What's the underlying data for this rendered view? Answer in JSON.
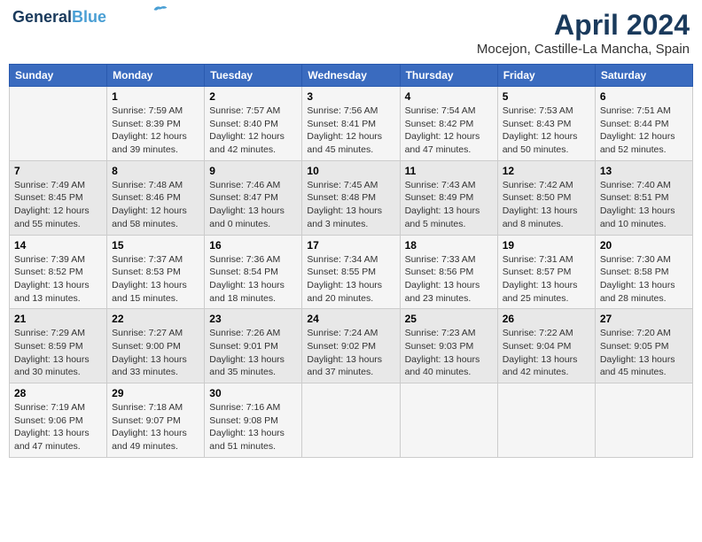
{
  "header": {
    "logo_line1": "General",
    "logo_line2": "Blue",
    "month": "April 2024",
    "location": "Mocejon, Castille-La Mancha, Spain"
  },
  "days_of_week": [
    "Sunday",
    "Monday",
    "Tuesday",
    "Wednesday",
    "Thursday",
    "Friday",
    "Saturday"
  ],
  "weeks": [
    [
      {
        "day": "",
        "info": ""
      },
      {
        "day": "1",
        "info": "Sunrise: 7:59 AM\nSunset: 8:39 PM\nDaylight: 12 hours\nand 39 minutes."
      },
      {
        "day": "2",
        "info": "Sunrise: 7:57 AM\nSunset: 8:40 PM\nDaylight: 12 hours\nand 42 minutes."
      },
      {
        "day": "3",
        "info": "Sunrise: 7:56 AM\nSunset: 8:41 PM\nDaylight: 12 hours\nand 45 minutes."
      },
      {
        "day": "4",
        "info": "Sunrise: 7:54 AM\nSunset: 8:42 PM\nDaylight: 12 hours\nand 47 minutes."
      },
      {
        "day": "5",
        "info": "Sunrise: 7:53 AM\nSunset: 8:43 PM\nDaylight: 12 hours\nand 50 minutes."
      },
      {
        "day": "6",
        "info": "Sunrise: 7:51 AM\nSunset: 8:44 PM\nDaylight: 12 hours\nand 52 minutes."
      }
    ],
    [
      {
        "day": "7",
        "info": "Sunrise: 7:49 AM\nSunset: 8:45 PM\nDaylight: 12 hours\nand 55 minutes."
      },
      {
        "day": "8",
        "info": "Sunrise: 7:48 AM\nSunset: 8:46 PM\nDaylight: 12 hours\nand 58 minutes."
      },
      {
        "day": "9",
        "info": "Sunrise: 7:46 AM\nSunset: 8:47 PM\nDaylight: 13 hours\nand 0 minutes."
      },
      {
        "day": "10",
        "info": "Sunrise: 7:45 AM\nSunset: 8:48 PM\nDaylight: 13 hours\nand 3 minutes."
      },
      {
        "day": "11",
        "info": "Sunrise: 7:43 AM\nSunset: 8:49 PM\nDaylight: 13 hours\nand 5 minutes."
      },
      {
        "day": "12",
        "info": "Sunrise: 7:42 AM\nSunset: 8:50 PM\nDaylight: 13 hours\nand 8 minutes."
      },
      {
        "day": "13",
        "info": "Sunrise: 7:40 AM\nSunset: 8:51 PM\nDaylight: 13 hours\nand 10 minutes."
      }
    ],
    [
      {
        "day": "14",
        "info": "Sunrise: 7:39 AM\nSunset: 8:52 PM\nDaylight: 13 hours\nand 13 minutes."
      },
      {
        "day": "15",
        "info": "Sunrise: 7:37 AM\nSunset: 8:53 PM\nDaylight: 13 hours\nand 15 minutes."
      },
      {
        "day": "16",
        "info": "Sunrise: 7:36 AM\nSunset: 8:54 PM\nDaylight: 13 hours\nand 18 minutes."
      },
      {
        "day": "17",
        "info": "Sunrise: 7:34 AM\nSunset: 8:55 PM\nDaylight: 13 hours\nand 20 minutes."
      },
      {
        "day": "18",
        "info": "Sunrise: 7:33 AM\nSunset: 8:56 PM\nDaylight: 13 hours\nand 23 minutes."
      },
      {
        "day": "19",
        "info": "Sunrise: 7:31 AM\nSunset: 8:57 PM\nDaylight: 13 hours\nand 25 minutes."
      },
      {
        "day": "20",
        "info": "Sunrise: 7:30 AM\nSunset: 8:58 PM\nDaylight: 13 hours\nand 28 minutes."
      }
    ],
    [
      {
        "day": "21",
        "info": "Sunrise: 7:29 AM\nSunset: 8:59 PM\nDaylight: 13 hours\nand 30 minutes."
      },
      {
        "day": "22",
        "info": "Sunrise: 7:27 AM\nSunset: 9:00 PM\nDaylight: 13 hours\nand 33 minutes."
      },
      {
        "day": "23",
        "info": "Sunrise: 7:26 AM\nSunset: 9:01 PM\nDaylight: 13 hours\nand 35 minutes."
      },
      {
        "day": "24",
        "info": "Sunrise: 7:24 AM\nSunset: 9:02 PM\nDaylight: 13 hours\nand 37 minutes."
      },
      {
        "day": "25",
        "info": "Sunrise: 7:23 AM\nSunset: 9:03 PM\nDaylight: 13 hours\nand 40 minutes."
      },
      {
        "day": "26",
        "info": "Sunrise: 7:22 AM\nSunset: 9:04 PM\nDaylight: 13 hours\nand 42 minutes."
      },
      {
        "day": "27",
        "info": "Sunrise: 7:20 AM\nSunset: 9:05 PM\nDaylight: 13 hours\nand 45 minutes."
      }
    ],
    [
      {
        "day": "28",
        "info": "Sunrise: 7:19 AM\nSunset: 9:06 PM\nDaylight: 13 hours\nand 47 minutes."
      },
      {
        "day": "29",
        "info": "Sunrise: 7:18 AM\nSunset: 9:07 PM\nDaylight: 13 hours\nand 49 minutes."
      },
      {
        "day": "30",
        "info": "Sunrise: 7:16 AM\nSunset: 9:08 PM\nDaylight: 13 hours\nand 51 minutes."
      },
      {
        "day": "",
        "info": ""
      },
      {
        "day": "",
        "info": ""
      },
      {
        "day": "",
        "info": ""
      },
      {
        "day": "",
        "info": ""
      }
    ]
  ]
}
